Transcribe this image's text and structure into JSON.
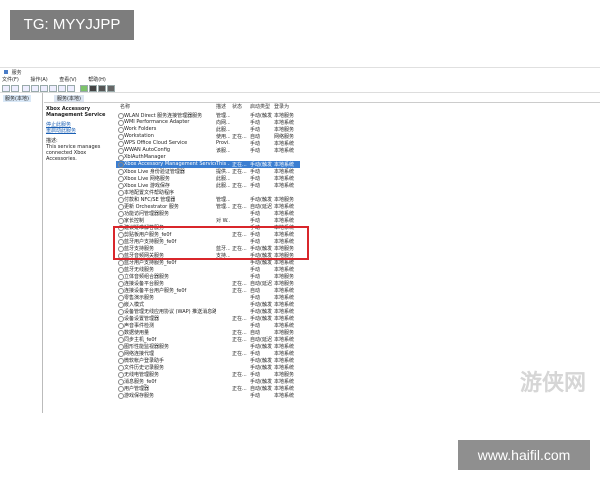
{
  "overlay": {
    "tg_label": "TG: MYYJJPP",
    "site_label": "www.haifil.com",
    "watermark": "游侠网"
  },
  "window": {
    "title": "服务",
    "menu": [
      "文件(F)",
      "操作(A)",
      "查看(V)",
      "帮助(H)"
    ],
    "tree_node": "服务(本地)",
    "pane_tab": "服务(本地)"
  },
  "details": {
    "service_title": "Xbox Accessory Management Service",
    "links": [
      "停止此服务",
      "重启动此服务"
    ],
    "desc_label": "描述:",
    "description": "This service manages connected Xbox Accessories."
  },
  "table": {
    "headers": [
      "名称",
      "描述",
      "状态",
      "启动类型",
      "登录为"
    ],
    "rows": [
      {
        "name": "WLAN Direct 服务连接管理器服务",
        "desc": "管理...",
        "status": "",
        "startup": "手动(触发...",
        "logon": "本地服务"
      },
      {
        "name": "WMI Performance Adapter",
        "desc": "向网...",
        "status": "",
        "startup": "手动",
        "logon": "本地系统"
      },
      {
        "name": "Work Folders",
        "desc": "此服...",
        "status": "",
        "startup": "手动",
        "logon": "本地服务"
      },
      {
        "name": "Workstation",
        "desc": "使用...",
        "status": "正在...",
        "startup": "自动",
        "logon": "网络服务"
      },
      {
        "name": "WPS Office Cloud Service",
        "desc": "Provi...",
        "status": "",
        "startup": "手动",
        "logon": "本地系统"
      },
      {
        "name": "WWAN AutoConfig",
        "desc": "该服...",
        "status": "",
        "startup": "手动",
        "logon": "本地系统"
      },
      {
        "name": "XblAuthManager",
        "desc": "",
        "status": "",
        "startup": "",
        "logon": ""
      },
      {
        "name": "Xbox Accessory Management Service",
        "desc": "This ...",
        "status": "正在...",
        "startup": "手动(触发...",
        "logon": "本地系统"
      },
      {
        "name": "Xbox Live 身份验证管理器",
        "desc": "提供...",
        "status": "正在...",
        "startup": "手动",
        "logon": "本地系统"
      },
      {
        "name": "Xbox Live 网络服务",
        "desc": "此服...",
        "status": "",
        "startup": "手动",
        "logon": "本地系统"
      },
      {
        "name": "Xbox Live 游戏保存",
        "desc": "此服...",
        "status": "正在...",
        "startup": "手动",
        "logon": "本地系统"
      },
      {
        "name": "本地配置文件帮助程序",
        "desc": "",
        "status": "",
        "startup": "",
        "logon": ""
      },
      {
        "name": "付款和 NFC/SE 管理器",
        "desc": "管理...",
        "status": "",
        "startup": "手动(触发...",
        "logon": "本地服务"
      },
      {
        "name": "更新 Orchestrator 服务",
        "desc": "管理...",
        "status": "正在...",
        "startup": "自动(延迟...",
        "logon": "本地系统"
      },
      {
        "name": "功能访问管理器服务",
        "desc": "",
        "status": "",
        "startup": "手动",
        "logon": "本地系统"
      },
      {
        "name": "家长控制",
        "desc": "对 W...",
        "status": "",
        "startup": "手动",
        "logon": "本地系统"
      },
      {
        "name": "建议疑难解答服务",
        "desc": "",
        "status": "",
        "startup": "手动",
        "logon": "本地系统"
      },
      {
        "name": "剪贴板用户服务_fe0f",
        "desc": "",
        "status": "正在...",
        "startup": "手动",
        "logon": "本地系统"
      },
      {
        "name": "蓝牙用户支持服务_fe0f",
        "desc": "",
        "status": "",
        "startup": "手动",
        "logon": "本地系统"
      },
      {
        "name": "蓝牙支持服务",
        "desc": "蓝牙...",
        "status": "正在...",
        "startup": "手动(触发...",
        "logon": "本地服务"
      },
      {
        "name": "蓝牙音频网关服务",
        "desc": "支持...",
        "status": "",
        "startup": "手动(触发...",
        "logon": "本地服务"
      },
      {
        "name": "蓝牙用户支持服务_fe0f",
        "desc": "",
        "status": "",
        "startup": "手动(触发...",
        "logon": "本地系统"
      },
      {
        "name": "蓝牙无线服务",
        "desc": "",
        "status": "",
        "startup": "手动",
        "logon": "本地系统"
      },
      {
        "name": "立体音频组合器服务",
        "desc": "",
        "status": "",
        "startup": "手动",
        "logon": "本地服务"
      },
      {
        "name": "连接设备平台服务",
        "desc": "",
        "status": "正在...",
        "startup": "自动(延迟...",
        "logon": "本地服务"
      },
      {
        "name": "连接设备平台用户服务_fe0f",
        "desc": "",
        "status": "正在...",
        "startup": "自动",
        "logon": "本地系统"
      },
      {
        "name": "零售演示服务",
        "desc": "",
        "status": "",
        "startup": "手动",
        "logon": "本地系统"
      },
      {
        "name": "嵌入模式",
        "desc": "",
        "status": "",
        "startup": "手动(触发...",
        "logon": "本地系统"
      },
      {
        "name": "设备管理无线应用协议 (WAP) 推送消息路由服务",
        "desc": "",
        "status": "",
        "startup": "手动(触发...",
        "logon": "本地系统"
      },
      {
        "name": "设备设置管理器",
        "desc": "",
        "status": "正在...",
        "startup": "手动(触发...",
        "logon": "本地系统"
      },
      {
        "name": "声音事件检测",
        "desc": "",
        "status": "",
        "startup": "手动",
        "logon": "本地系统"
      },
      {
        "name": "数据使用量",
        "desc": "",
        "status": "正在...",
        "startup": "自动",
        "logon": "本地服务"
      },
      {
        "name": "同步主机_fe0f",
        "desc": "",
        "status": "正在...",
        "startup": "自动(延迟...",
        "logon": "本地系统"
      },
      {
        "name": "图形性能监视器服务",
        "desc": "",
        "status": "",
        "startup": "手动(触发...",
        "logon": "本地系统"
      },
      {
        "name": "网络连接代理",
        "desc": "",
        "status": "正在...",
        "startup": "手动",
        "logon": "本地系统"
      },
      {
        "name": "微软帐户登录助手",
        "desc": "",
        "status": "",
        "startup": "手动(触发...",
        "logon": "本地系统"
      },
      {
        "name": "文件历史记录服务",
        "desc": "",
        "status": "",
        "startup": "手动(触发...",
        "logon": "本地系统"
      },
      {
        "name": "无线电管理服务",
        "desc": "",
        "status": "正在...",
        "startup": "手动",
        "logon": "本地服务"
      },
      {
        "name": "消息服务_fe0f",
        "desc": "",
        "status": "",
        "startup": "手动(触发...",
        "logon": "本地系统"
      },
      {
        "name": "用户管理器",
        "desc": "",
        "status": "正在...",
        "startup": "自动(触发...",
        "logon": "本地系统"
      },
      {
        "name": "游戏保存服务",
        "desc": "",
        "status": "",
        "startup": "手动",
        "logon": "本地系统"
      }
    ]
  }
}
